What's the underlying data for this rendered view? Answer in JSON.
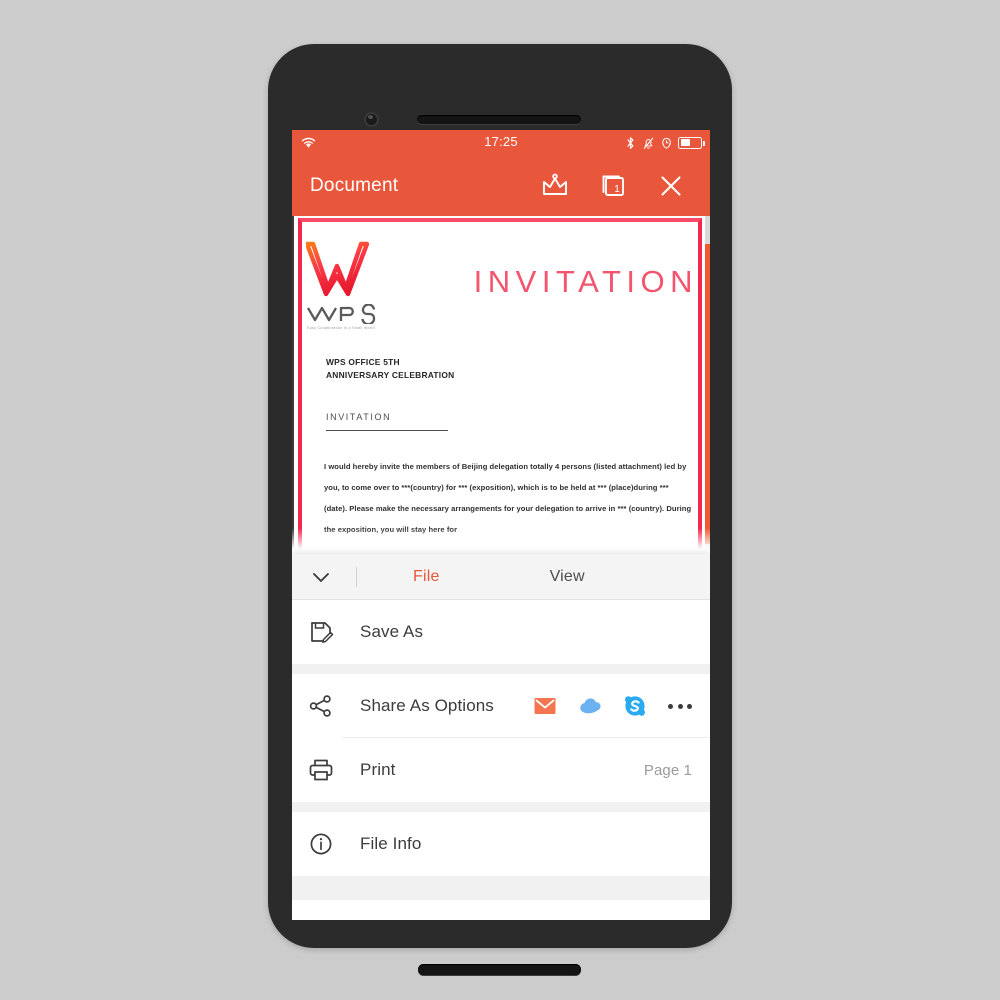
{
  "status_bar": {
    "time": "17:25",
    "wifi_icon": "wifi-icon",
    "bluetooth_icon": "bluetooth-icon",
    "silent_icon": "bell-muted-icon",
    "alarm_icon": "alarm-clock-icon",
    "battery_icon": "battery-icon"
  },
  "toolbar": {
    "title": "Document",
    "premium_icon": "crown-icon",
    "tabs_icon": "document-tabs-icon",
    "tab_count": "1",
    "close_icon": "close-icon",
    "background": "#e8573b"
  },
  "document": {
    "logo_word": "WPS",
    "logo_tagline": "Easy Collaboration in a Small World",
    "invitation_title": "INVITATION",
    "heading_line1": "WPS OFFICE 5TH",
    "heading_line2": "ANNIVERSARY CELEBRATION",
    "subheading": "INVITATION",
    "body": "I would hereby invite the members of Beijing delegation totally 4 persons (listed attachment) led by you, to come over to ***(country) for *** (exposition), which is to be held at *** (place)during *** (date). Please make the necessary arrangements for your delegation to arrive in *** (country). During the exposition, you will stay here for",
    "border_color": "#f4274e",
    "title_color": "#f4546d",
    "scrollbar_color": "#ef5a33"
  },
  "sheet": {
    "collapse_icon": "chevron-down-icon",
    "tabs": [
      {
        "label": "File",
        "active": true
      },
      {
        "label": "View",
        "active": false
      }
    ],
    "active_tab_color": "#e8573b",
    "rows": [
      {
        "label": "Save As",
        "icon": "save-as-icon",
        "value": ""
      },
      {
        "label": "Share As Options",
        "icon": "share-nodes-icon",
        "share_targets": [
          {
            "name": "email-icon",
            "color": "#f4754f"
          },
          {
            "name": "cloud-icon",
            "color": "#6cb2f0"
          },
          {
            "name": "skype-icon",
            "color": "#2aaaf0"
          },
          {
            "name": "more-options-icon",
            "color": "#3c3c3c"
          }
        ]
      },
      {
        "label": "Print",
        "icon": "printer-icon",
        "value": "Page 1"
      },
      {
        "label": "File Info",
        "icon": "info-circle-icon",
        "value": ""
      }
    ]
  }
}
